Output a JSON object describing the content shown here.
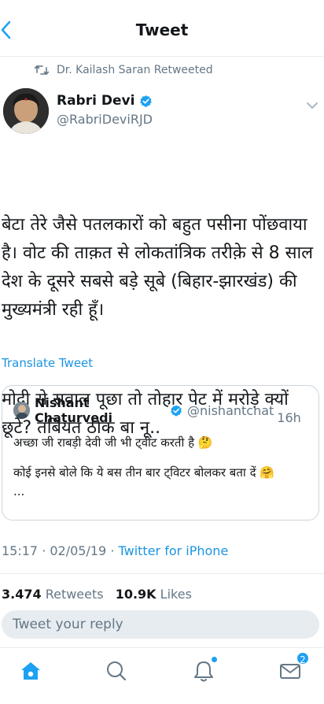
{
  "header": {
    "title": "Tweet"
  },
  "retweet": {
    "text": "Dr. Kailash Saran Retweeted"
  },
  "author": {
    "name": "Rabri Devi",
    "handle": "@RabriDeviRJD"
  },
  "tweet": {
    "paragraph1": "बेटा तेरे जैसे पतलकारों को बहुत पसीना पोंछवाया है। वोट की ताक़त से लोकतांत्रिक तरीक़े से 8 साल देश के दूसरे सबसे बड़े सूबे (बिहार-झारखंड) की मुख्यमंत्री रही हूँ।",
    "paragraph2": "मोदी से सवाल पूछा तो तोहार पेट में मरोड़े क्यों छूटे? तबियत ठीक बा नू.."
  },
  "translate": {
    "label": "Translate Tweet"
  },
  "quote": {
    "name": "Nishant Chaturvedi",
    "handle": "@nishantchat",
    "time": "· 16h",
    "line1": "अच्छा जी राबड़ी देवी जी भी ट्वीट करती है 🤔",
    "line2": "कोई इनसे बोले कि ये बस तीन बार ट्विटर बोलकर बता दें 🤗",
    "line3": "..."
  },
  "meta": {
    "time": "15:17 · 02/05/19 · ",
    "source": "Twitter for iPhone"
  },
  "stats": {
    "retweets_count": "3.474",
    "retweets_label": "Retweets",
    "likes_count": "10.9K",
    "likes_label": "Likes"
  },
  "reply": {
    "placeholder": "Tweet your reply"
  },
  "tabs": {
    "messages_badge": "2"
  },
  "colors": {
    "accent": "#1DA1F2",
    "link": "#1B95E0",
    "muted": "#657786",
    "divider": "#E6ECF0"
  }
}
